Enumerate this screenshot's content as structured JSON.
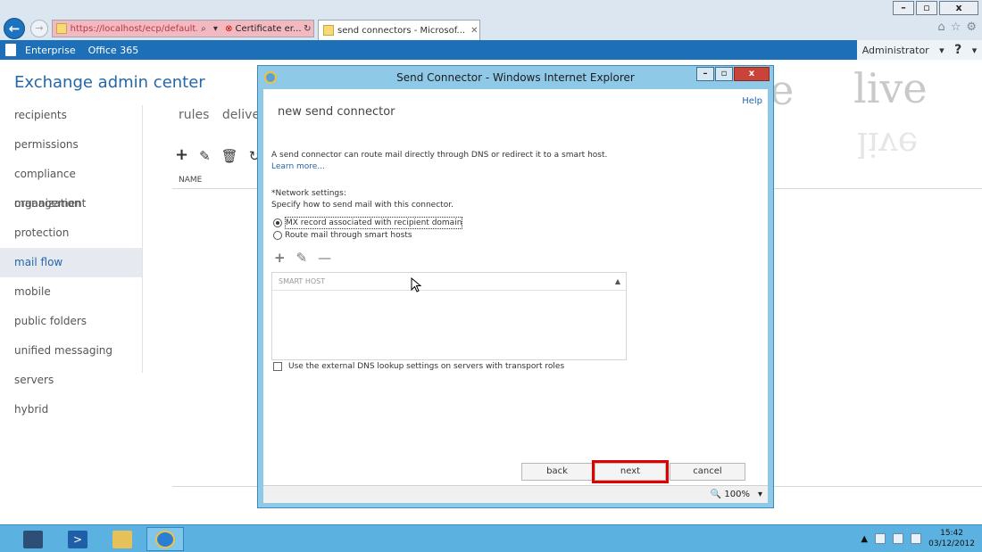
{
  "browser": {
    "url": "https://localhost/ecp/default.aspx",
    "cert_error": "Certificate er...",
    "tab_title": "send connectors - Microsof...",
    "window_buttons": [
      "–",
      "▫",
      "x"
    ]
  },
  "topbar": {
    "enterprise": "Enterprise",
    "office365": "Office 365",
    "user": "Administrator",
    "help": "?"
  },
  "eac": {
    "title": "Exchange admin center",
    "nav": [
      {
        "label": "recipients",
        "active": false
      },
      {
        "label": "permissions",
        "active": false
      },
      {
        "label": "compliance management",
        "active": false
      },
      {
        "label": "organization",
        "active": false
      },
      {
        "label": "protection",
        "active": false
      },
      {
        "label": "mail flow",
        "active": true
      },
      {
        "label": "mobile",
        "active": false
      },
      {
        "label": "public folders",
        "active": false
      },
      {
        "label": "unified messaging",
        "active": false
      },
      {
        "label": "servers",
        "active": false
      },
      {
        "label": "hybrid",
        "active": false
      }
    ],
    "subnav": [
      "rules",
      "delivery"
    ],
    "column_name": "NAME"
  },
  "watermark": {
    "word1": "pete",
    "word2": "live"
  },
  "dialog": {
    "title": "Send Connector - Windows Internet Explorer",
    "help": "Help",
    "form_title": "new send connector",
    "description": "A send connector can route mail directly through DNS or redirect it to a smart host.",
    "learn_more": "Learn more...",
    "network_label": "*Network settings:",
    "network_sub": "Specify how to send mail with this connector.",
    "option1": "MX record associated with recipient domain",
    "option2": "Route mail through smart hosts",
    "table_header": "SMART HOST",
    "dns_checkbox": "Use the external DNS lookup settings on servers with transport roles",
    "buttons": {
      "back": "back",
      "next": "next",
      "cancel": "cancel"
    },
    "zoom": "100%"
  },
  "taskbar": {
    "time": "15:42",
    "date": "03/12/2012"
  },
  "colors": {
    "accent": "#1d6fb8",
    "highlight": "#e10000",
    "dialog_frame": "#8fc9e8"
  }
}
